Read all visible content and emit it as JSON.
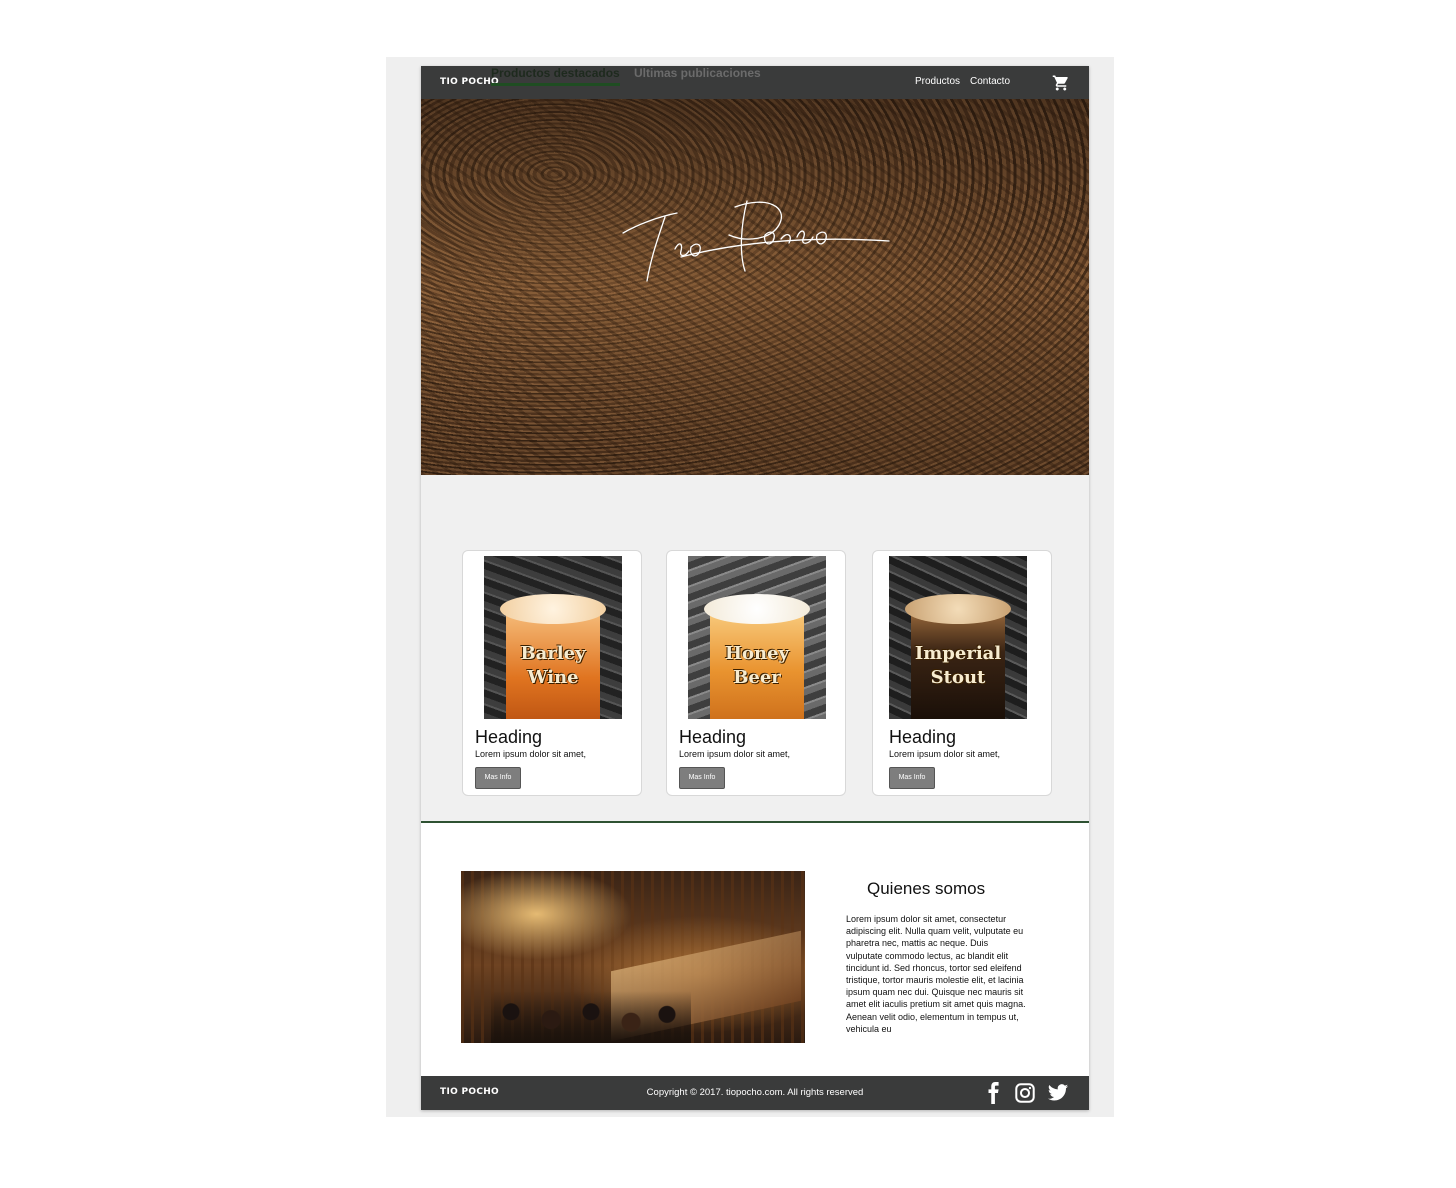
{
  "nav": {
    "brand": "TIO POCHO",
    "links": [
      "Productos",
      "Contacto"
    ],
    "cart_icon": "cart-icon"
  },
  "hero": {
    "logo_signature": "Tio Pocho"
  },
  "tabs": [
    {
      "label": "Productos destacados",
      "active": true
    },
    {
      "label": "Ultimas publicaciones",
      "active": false
    }
  ],
  "products": [
    {
      "image_label": [
        "Barley",
        "Wine"
      ],
      "title": "Heading",
      "text": "Lorem ipsum dolor sit amet,",
      "button": "Mas Info"
    },
    {
      "image_label": [
        "Honey",
        "Beer"
      ],
      "title": "Heading",
      "text": "Lorem ipsum dolor sit amet,",
      "button": "Mas Info"
    },
    {
      "image_label": [
        "Imperial",
        "Stout"
      ],
      "title": "Heading",
      "text": "Lorem ipsum dolor sit amet,",
      "button": "Mas Info"
    }
  ],
  "about": {
    "title": "Quienes somos",
    "text": "Lorem ipsum dolor sit amet, consectetur adipiscing elit. Nulla quam velit, vulputate eu pharetra nec, mattis ac neque. Duis vulputate commodo lectus, ac blandit elit tincidunt id. Sed rhoncus, tortor sed eleifend tristique, tortor mauris molestie elit, et lacinia ipsum quam nec dui. Quisque nec mauris sit amet elit iaculis pretium sit amet quis magna. Aenean velit odio, elementum in tempus ut, vehicula eu"
  },
  "footer": {
    "brand": "TIO POCHO",
    "copyright": "Copyright © 2017. tiopocho.com. All rights reserved",
    "social_icons": [
      "facebook-icon",
      "instagram-icon",
      "twitter-icon"
    ]
  },
  "colors": {
    "nav_bg": "#3a3b3b",
    "accent_green": "#1f4d22",
    "button_gray": "#7e7e7e"
  }
}
